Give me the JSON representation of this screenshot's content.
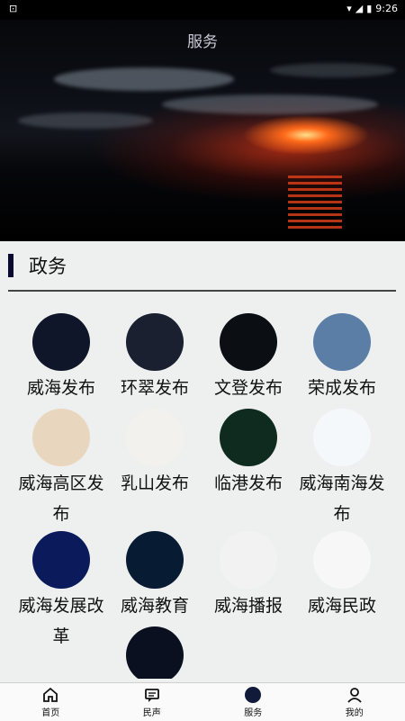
{
  "status_bar": {
    "time": "9:26"
  },
  "header": {
    "title": "服务"
  },
  "section": {
    "title": "政务"
  },
  "services": [
    {
      "label": "威海发布",
      "icon": "weihai-fabu-logo",
      "bg": "#10162a"
    },
    {
      "label": "环翠发布",
      "icon": "huancui-fabu-logo",
      "bg": "#1a2030"
    },
    {
      "label": "文登发布",
      "icon": "wendeng-fabu-logo",
      "bg": "#0b0f14"
    },
    {
      "label": "荣成发布",
      "icon": "rongcheng-fabu-logo",
      "bg": "#5a7ea6"
    },
    {
      "label": "威海高区发布",
      "icon": "gaoqu-fabu-logo",
      "bg": "#e9d6bf"
    },
    {
      "label": "乳山发布",
      "icon": "rushan-fabu-logo",
      "bg": "#f3f1ee"
    },
    {
      "label": "临港发布",
      "icon": "lingang-fabu-logo",
      "bg": "#0f2a1f"
    },
    {
      "label": "威海南海发布",
      "icon": "nanhai-fabu-logo",
      "bg": "#f5f8fb"
    },
    {
      "label": "威海发展改革",
      "icon": "fazhan-gaige-logo",
      "bg": "#0a1a5a"
    },
    {
      "label": "威海教育",
      "icon": "weihai-jiaoyu-logo",
      "bg": "#071b33"
    },
    {
      "label": "威海播报",
      "icon": "weihai-bobao-logo",
      "bg": "#f2f2f2"
    },
    {
      "label": "威海民政",
      "icon": "weihai-minzheng-logo",
      "bg": "#f7f7f7"
    },
    {
      "label": "",
      "icon": "row4-logo-1",
      "bg": "#0a1020"
    },
    {
      "label": "",
      "icon": "row4-logo-2",
      "bg": "#eef0f0"
    },
    {
      "label": "",
      "icon": "row4-logo-3",
      "bg": "#eef0f0"
    }
  ],
  "nav": [
    {
      "label": "首页",
      "icon": "home-icon"
    },
    {
      "label": "民声",
      "icon": "message-icon"
    },
    {
      "label": "服务",
      "icon": "service-icon"
    },
    {
      "label": "我的",
      "icon": "user-icon"
    }
  ]
}
